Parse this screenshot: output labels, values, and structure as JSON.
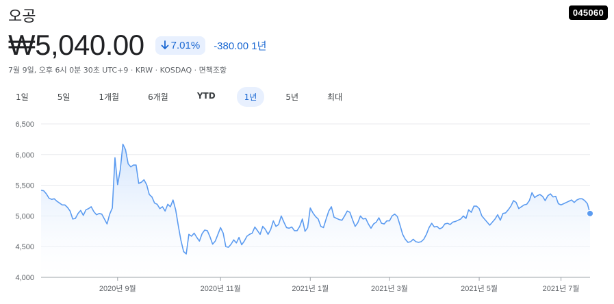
{
  "header": {
    "company_name": "오공",
    "ticker": "045060",
    "price": "₩5,040.00",
    "change_pct": "7.01%",
    "change_abs": "-380.00 1년",
    "meta": "7월 9일, 오후 6시 0분 30초 UTC+9 · KRW · KOSDAQ · 면책조항"
  },
  "tabs": [
    "1일",
    "5일",
    "1개월",
    "6개월",
    "YTD",
    "1년",
    "5년",
    "최대"
  ],
  "active_tab": "1년",
  "colors": {
    "line": "#5b9bf0",
    "fill_top": "#cfe2fc",
    "accent": "#1967d2",
    "pill_bg": "#e8f0fe"
  },
  "chart_data": {
    "type": "area",
    "title": "",
    "xlabel": "",
    "ylabel": "",
    "ylim": [
      4000,
      6500
    ],
    "yticks": [
      4000,
      4500,
      5000,
      5500,
      6000,
      6500
    ],
    "ytick_labels": [
      "4,000",
      "4,500",
      "5,000",
      "5,500",
      "6,000",
      "6,500"
    ],
    "xticks": [
      {
        "label": "2020년 9월",
        "index": 29
      },
      {
        "label": "2020년 11월",
        "index": 68
      },
      {
        "label": "2021년 1월",
        "index": 102
      },
      {
        "label": "2021년 3월",
        "index": 132
      },
      {
        "label": "2021년 5월",
        "index": 166
      },
      {
        "label": "2021년 7월",
        "index": 197
      }
    ],
    "grid": true,
    "series": [
      {
        "values": [
          5420,
          5410,
          5360,
          5290,
          5270,
          5280,
          5240,
          5210,
          5180,
          5180,
          5140,
          5080,
          4950,
          4960,
          5040,
          5090,
          5010,
          5100,
          5120,
          5150,
          5070,
          5020,
          5040,
          5030,
          4950,
          4870,
          5030,
          5130,
          5950,
          5510,
          5750,
          6170,
          6080,
          5850,
          5800,
          5830,
          5830,
          5530,
          5550,
          5590,
          5510,
          5350,
          5310,
          5210,
          5190,
          5120,
          5150,
          5080,
          5190,
          5150,
          5260,
          5100,
          4840,
          4600,
          4420,
          4380,
          4700,
          4670,
          4720,
          4650,
          4590,
          4710,
          4770,
          4760,
          4660,
          4540,
          4590,
          4700,
          4810,
          4720,
          4500,
          4490,
          4540,
          4610,
          4560,
          4650,
          4530,
          4590,
          4670,
          4700,
          4720,
          4820,
          4760,
          4700,
          4830,
          4780,
          4700,
          4780,
          4920,
          4830,
          4860,
          5000,
          4900,
          4810,
          4800,
          4820,
          4760,
          4760,
          4830,
          4950,
          4750,
          4810,
          5130,
          5050,
          4990,
          4950,
          4830,
          4810,
          4950,
          5080,
          5150,
          4980,
          4960,
          4940,
          4930,
          5000,
          5080,
          5060,
          4940,
          4830,
          4890,
          5000,
          4950,
          4960,
          4870,
          4800,
          4870,
          4900,
          4970,
          4880,
          4870,
          4920,
          4920,
          5000,
          5030,
          4990,
          4850,
          4700,
          4620,
          4570,
          4580,
          4620,
          4580,
          4570,
          4580,
          4620,
          4700,
          4810,
          4880,
          4820,
          4830,
          4790,
          4810,
          4870,
          4880,
          4860,
          4900,
          4910,
          4930,
          4950,
          5000,
          4960,
          5100,
          5060,
          5160,
          5160,
          5120,
          5000,
          4950,
          4900,
          4850,
          4900,
          4950,
          5020,
          4930,
          5040,
          5050,
          5100,
          5160,
          5250,
          5220,
          5120,
          5150,
          5180,
          5190,
          5250,
          5380,
          5300,
          5330,
          5350,
          5320,
          5250,
          5330,
          5360,
          5310,
          5320,
          5200,
          5180,
          5200,
          5220,
          5240,
          5260,
          5220,
          5260,
          5280,
          5280,
          5250,
          5200,
          5040
        ]
      }
    ]
  }
}
